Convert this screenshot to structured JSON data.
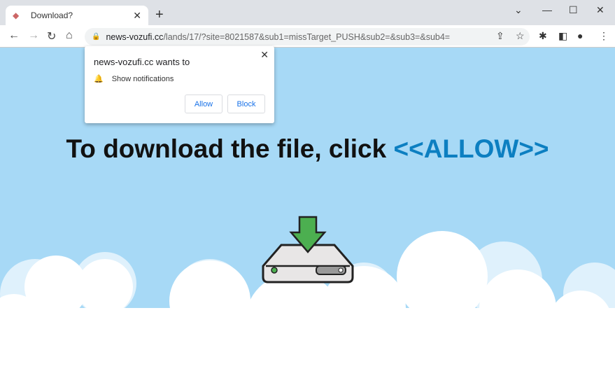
{
  "browser": {
    "tab_title": "Download?",
    "url_host": "news-vozufi.cc",
    "url_path": "/lands/17/?site=8021587&sub1=missTarget_PUSH&sub2=&sub3=&sub4="
  },
  "popup": {
    "title": "news-vozufi.cc wants to",
    "permission": "Show notifications",
    "allow": "Allow",
    "block": "Block"
  },
  "page": {
    "headline": "To download the file, click ",
    "headline_cta": "<<ALLOW>>"
  },
  "colors": {
    "sky": "#a7d9f6",
    "cta": "#0c7fc1",
    "arrow": "#4caf50"
  }
}
